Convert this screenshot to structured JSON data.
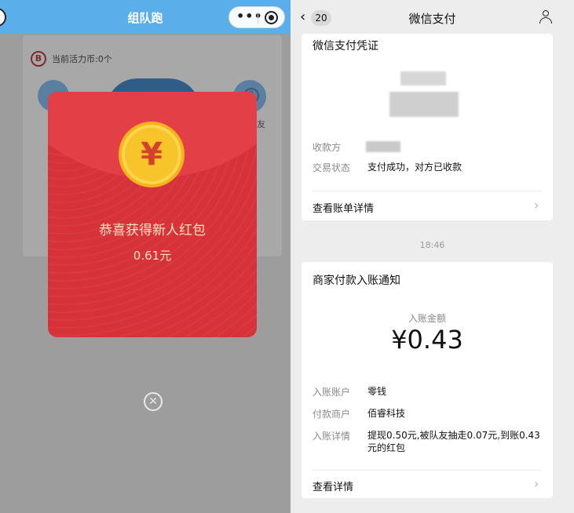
{
  "left": {
    "title": "组队跑",
    "capsule_more": "•••",
    "activity_coin_icon": "B",
    "activity_coin_text": "当前活力币:0个",
    "side_text": "友",
    "packet": {
      "coin_symbol": "¥",
      "title": "恭喜获得新人红包",
      "amount": "0.61元"
    },
    "close_symbol": "✕"
  },
  "right": {
    "header": {
      "back_symbol": "‹",
      "unread_count": "20",
      "title": "微信支付"
    },
    "voucher_card": {
      "title": "微信支付凭证",
      "rows": [
        {
          "label": "收款方",
          "value": ""
        },
        {
          "label": "交易状态",
          "value": "支付成功，对方已收款"
        }
      ],
      "link": "查看账单详情",
      "chevron": "›"
    },
    "timestamp": "18:46",
    "notice_card": {
      "title": "商家付款入账通知",
      "amount_label": "入账金额",
      "amount_value": "¥0.43",
      "rows": [
        {
          "label": "入账账户",
          "value": "零钱"
        },
        {
          "label": "付款商户",
          "value": "佰睿科技"
        },
        {
          "label": "入账详情",
          "value": "提现0.50元,被队友抽走0.07元,到账0.43元的红包"
        }
      ],
      "link": "查看详情",
      "chevron": "›"
    }
  },
  "colors": {
    "header_blue": "#5aaeea",
    "packet_red": "#d7323a",
    "coin_gold": "#f7c42a",
    "wechat_bg": "#ededed"
  }
}
